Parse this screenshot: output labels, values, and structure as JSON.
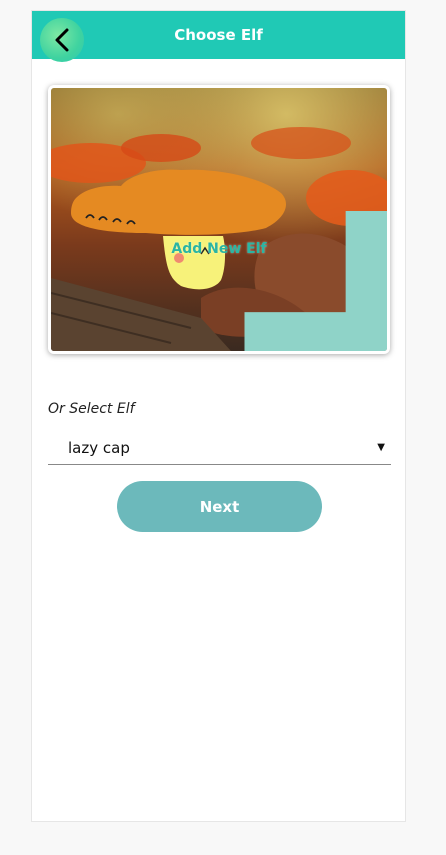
{
  "header": {
    "title": "Choose Elf",
    "back_icon": "chevron-left-icon"
  },
  "image_card": {
    "add_label": "Add New Elf",
    "add_icon": "plus-icon"
  },
  "select": {
    "label": "Or Select Elf",
    "value": "lazy cap",
    "arrow_icon": "caret-down-icon"
  },
  "next_button": {
    "label": "Next"
  },
  "colors": {
    "header": "#20c9b5",
    "next_button": "#6cb9bb",
    "accent_text": "#2bb5a3"
  }
}
